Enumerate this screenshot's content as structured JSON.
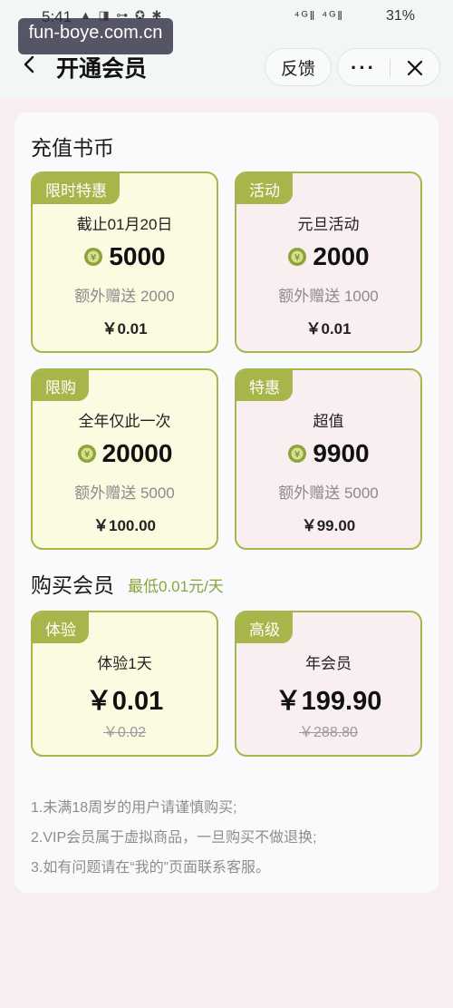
{
  "status_bar": {
    "time": "5:41",
    "left_icons": "▲ ◨ ⊶ ✪ ✱",
    "signal": "⁴ᴳ‖ ⁴ᴳ‖",
    "battery": "31%"
  },
  "watermark": "fun-boye.com.cn",
  "navbar": {
    "title": "开通会员",
    "feedback": "反馈",
    "more": "···"
  },
  "recharge": {
    "title": "充值书币",
    "cards": [
      {
        "badge": "限时特惠",
        "label": "截止01月20日",
        "amount": "5000",
        "bonus": "额外赠送 2000",
        "price": "￥0.01"
      },
      {
        "badge": "活动",
        "label": "元旦活动",
        "amount": "2000",
        "bonus": "额外赠送 1000",
        "price": "￥0.01"
      },
      {
        "badge": "限购",
        "label": "全年仅此一次",
        "amount": "20000",
        "bonus": "额外赠送 5000",
        "price": "￥100.00"
      },
      {
        "badge": "特惠",
        "label": "超值",
        "amount": "9900",
        "bonus": "额外赠送 5000",
        "price": "￥99.00"
      }
    ]
  },
  "vip": {
    "title": "购买会员",
    "subtitle": "最低0.01元/天",
    "cards": [
      {
        "badge": "体验",
        "label": "体验1天",
        "price": "￥0.01",
        "original": "￥0.02"
      },
      {
        "badge": "高级",
        "label": "年会员",
        "price": "￥199.90",
        "original": "￥288.80"
      }
    ]
  },
  "notes": [
    "1.未满18周岁的用户请谨慎购买;",
    "2.VIP会员属于虚拟商品，一旦购买不做退换;",
    "3.如有问题请在“我的”页面联系客服。"
  ],
  "colors": {
    "accent": "#a8b54a",
    "card_yellow": "#fbfbe1",
    "card_pink": "#f9eef0",
    "page_bg": "#f8eeef"
  },
  "icons": [
    "back-arrow-icon",
    "more-icon",
    "close-icon",
    "coin-icon"
  ]
}
